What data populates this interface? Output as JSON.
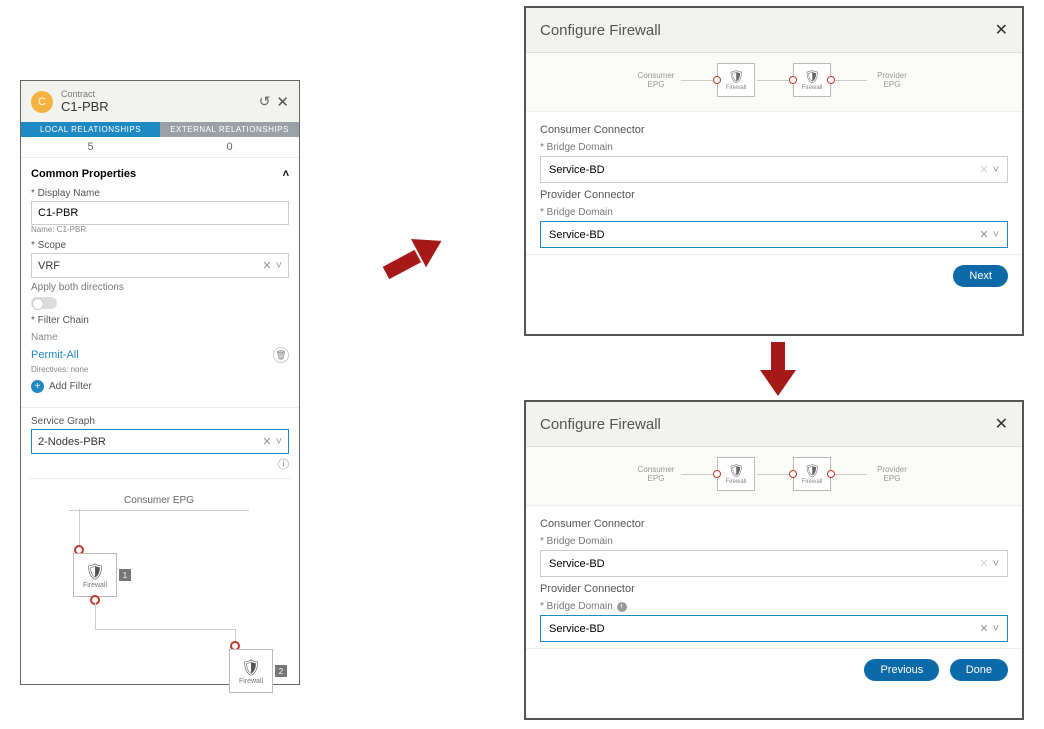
{
  "leftPanel": {
    "badge": "C",
    "subtitle": "Contract",
    "title": "C1-PBR",
    "tabs": {
      "local": "LOCAL RELATIONSHIPS",
      "external": "EXTERNAL RELATIONSHIPS",
      "localCount": "5",
      "externalCount": "0"
    },
    "commonPropsHeader": "Common Properties",
    "displayNameLabel": "* Display Name",
    "displayNameValue": "C1-PBR",
    "nameLine": "Name: C1-PBR",
    "scopeLabel": "* Scope",
    "scopeValue": "VRF",
    "applyBothLabel": "Apply both directions",
    "filterChainLabel": "* Filter Chain",
    "filterNameLabel": "Name",
    "filterValue": "Permit-All",
    "directivesLine": "Directives: none",
    "addFilterLabel": "Add Filter",
    "serviceGraphLabel": "Service Graph",
    "serviceGraphValue": "2-Nodes-PBR",
    "graph": {
      "consumerEpg": "Consumer EPG",
      "firewallLabel": "Firewall",
      "node1": "1",
      "node2": "2"
    }
  },
  "modal1": {
    "title": "Configure Firewall",
    "diag": {
      "consumer": "Consumer",
      "consumerSub": "EPG",
      "provider": "Provider",
      "providerSub": "EPG",
      "firewall": "Firewall"
    },
    "consumerConnector": "Consumer Connector",
    "bridgeDomainLabel": "* Bridge Domain",
    "consumerBD": "Service-BD",
    "providerConnector": "Provider Connector",
    "providerBD": "Service-BD",
    "nextBtn": "Next"
  },
  "modal2": {
    "title": "Configure Firewall",
    "diag": {
      "consumer": "Consumer",
      "consumerSub": "EPG",
      "provider": "Provider",
      "providerSub": "EPG",
      "firewall": "Firewall"
    },
    "consumerConnector": "Consumer Connector",
    "bridgeDomainLabel": "* Bridge Domain",
    "consumerBD": "Service-BD",
    "providerConnector": "Provider Connector",
    "providerBDLabel": "* Bridge Domain",
    "providerBD": "Service-BD",
    "prevBtn": "Previous",
    "doneBtn": "Done"
  }
}
